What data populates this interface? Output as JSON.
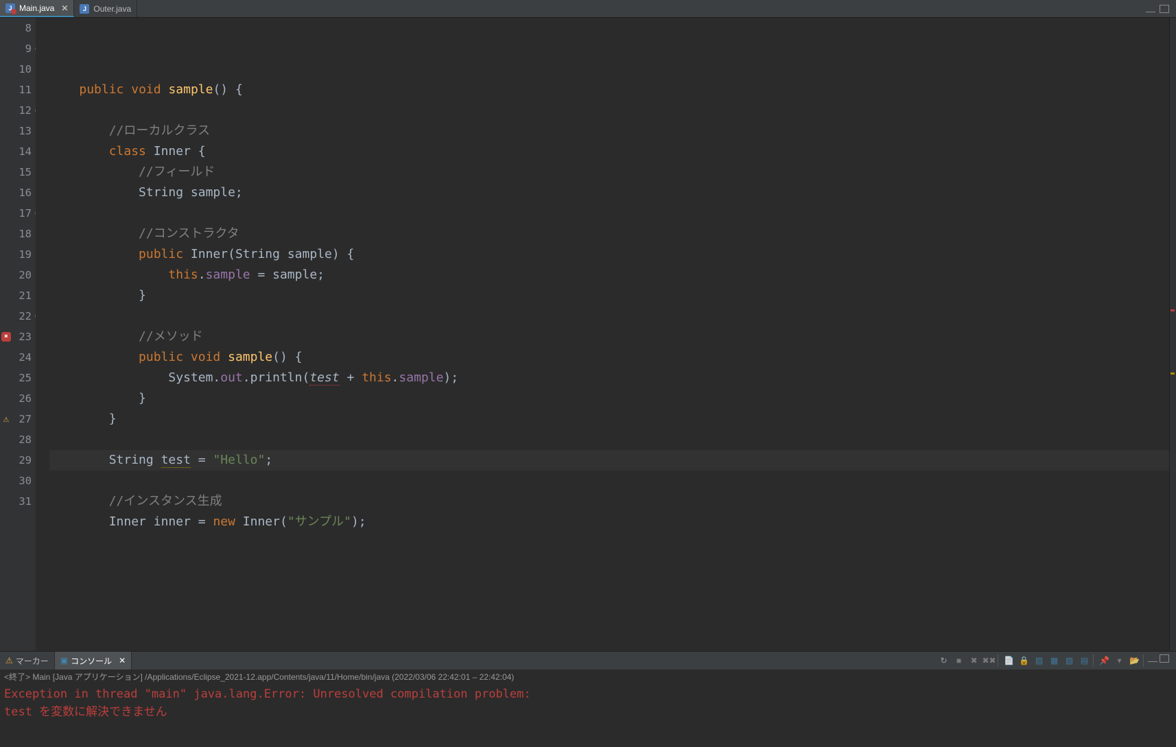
{
  "tabs": [
    {
      "label": "Main.java",
      "active": true,
      "hasError": true
    },
    {
      "label": "Outer.java",
      "active": false,
      "hasError": false
    }
  ],
  "code": {
    "startLineNumber": 8,
    "lines": [
      {
        "ln": 8,
        "bullet": false,
        "marker": "",
        "cls": "",
        "html": ""
      },
      {
        "ln": 9,
        "bullet": true,
        "marker": "",
        "cls": "",
        "html": "    <span class='color-keyword'>public</span> <span class='color-keyword'>void</span> <span class='color-method'>sample</span>() {"
      },
      {
        "ln": 10,
        "bullet": false,
        "marker": "",
        "cls": "",
        "html": "        "
      },
      {
        "ln": 11,
        "bullet": false,
        "marker": "",
        "cls": "",
        "html": "        <span class='color-comment'>//ローカルクラス</span>"
      },
      {
        "ln": 12,
        "bullet": true,
        "marker": "",
        "cls": "",
        "html": "        <span class='color-keyword'>class</span> <span class='color-class'>Inner</span> {"
      },
      {
        "ln": 13,
        "bullet": false,
        "marker": "",
        "cls": "",
        "html": "            <span class='color-comment'>//フィールド</span>"
      },
      {
        "ln": 14,
        "bullet": false,
        "marker": "",
        "cls": "",
        "html": "            <span class='color-type'>String</span> sample;"
      },
      {
        "ln": 15,
        "bullet": false,
        "marker": "",
        "cls": "",
        "html": "            "
      },
      {
        "ln": 16,
        "bullet": false,
        "marker": "",
        "cls": "",
        "html": "            <span class='color-comment'>//コンストラクタ</span>"
      },
      {
        "ln": 17,
        "bullet": true,
        "marker": "",
        "cls": "",
        "html": "            <span class='color-keyword'>public</span> <span class='color-class'>Inner</span>(<span class='color-type'>String</span> sample) {"
      },
      {
        "ln": 18,
        "bullet": false,
        "marker": "",
        "cls": "",
        "html": "                <span class='color-keyword'>this</span>.<span class='color-field'>sample</span> = sample;"
      },
      {
        "ln": 19,
        "bullet": false,
        "marker": "",
        "cls": "",
        "html": "            }"
      },
      {
        "ln": 20,
        "bullet": false,
        "marker": "",
        "cls": "",
        "html": "            "
      },
      {
        "ln": 21,
        "bullet": false,
        "marker": "",
        "cls": "",
        "html": "            <span class='color-comment'>//メソッド</span>"
      },
      {
        "ln": 22,
        "bullet": true,
        "marker": "",
        "cls": "",
        "html": "            <span class='color-keyword'>public</span> <span class='color-keyword'>void</span> <span class='color-method'>sample</span>() {"
      },
      {
        "ln": 23,
        "bullet": false,
        "marker": "error",
        "cls": "",
        "html": "                System.<span class='color-sysout'>out</span>.println(<span class='underline-error'>test</span> + <span class='color-keyword'>this</span>.<span class='color-field'>sample</span>);"
      },
      {
        "ln": 24,
        "bullet": false,
        "marker": "",
        "cls": "",
        "html": "            }"
      },
      {
        "ln": 25,
        "bullet": false,
        "marker": "",
        "cls": "",
        "html": "        }"
      },
      {
        "ln": 26,
        "bullet": false,
        "marker": "",
        "cls": "",
        "html": "        "
      },
      {
        "ln": 27,
        "bullet": false,
        "marker": "warn",
        "cls": "hl",
        "html": "        <span class='color-type'>String</span> <span class='underline-warn'>test</span> = <span class='color-string'>\"Hello\"</span>;"
      },
      {
        "ln": 28,
        "bullet": false,
        "marker": "",
        "cls": "",
        "html": "        "
      },
      {
        "ln": 29,
        "bullet": false,
        "marker": "",
        "cls": "",
        "html": "        <span class='color-comment'>//インスタンス生成</span>"
      },
      {
        "ln": 30,
        "bullet": false,
        "marker": "",
        "cls": "",
        "html": "        <span class='color-type'>Inner</span> inner = <span class='color-keyword'>new</span> <span class='color-class'>Inner</span>(<span class='color-string'>\"サンプル\"</span>);"
      },
      {
        "ln": 31,
        "bullet": false,
        "marker": "",
        "cls": "",
        "html": "        "
      }
    ]
  },
  "bottom": {
    "tabs": [
      {
        "label": "マーカー",
        "active": false,
        "icon": "marker"
      },
      {
        "label": "コンソール",
        "active": true,
        "icon": "console"
      }
    ],
    "consoleHeader": "<終了> Main [Java アプリケーション] /Applications/Eclipse_2021-12.app/Contents/java/11/Home/bin/java  (2022/03/06 22:42:01 – 22:42:04)",
    "consoleLines": [
      "Exception in thread \"main\" java.lang.Error: Unresolved compilation problem: ",
      "    test を変数に解決できません"
    ]
  },
  "ruler": {
    "marks": [
      {
        "topPct": 46,
        "cls": "red-mark"
      },
      {
        "topPct": 56,
        "cls": "yellow-mark"
      }
    ]
  }
}
